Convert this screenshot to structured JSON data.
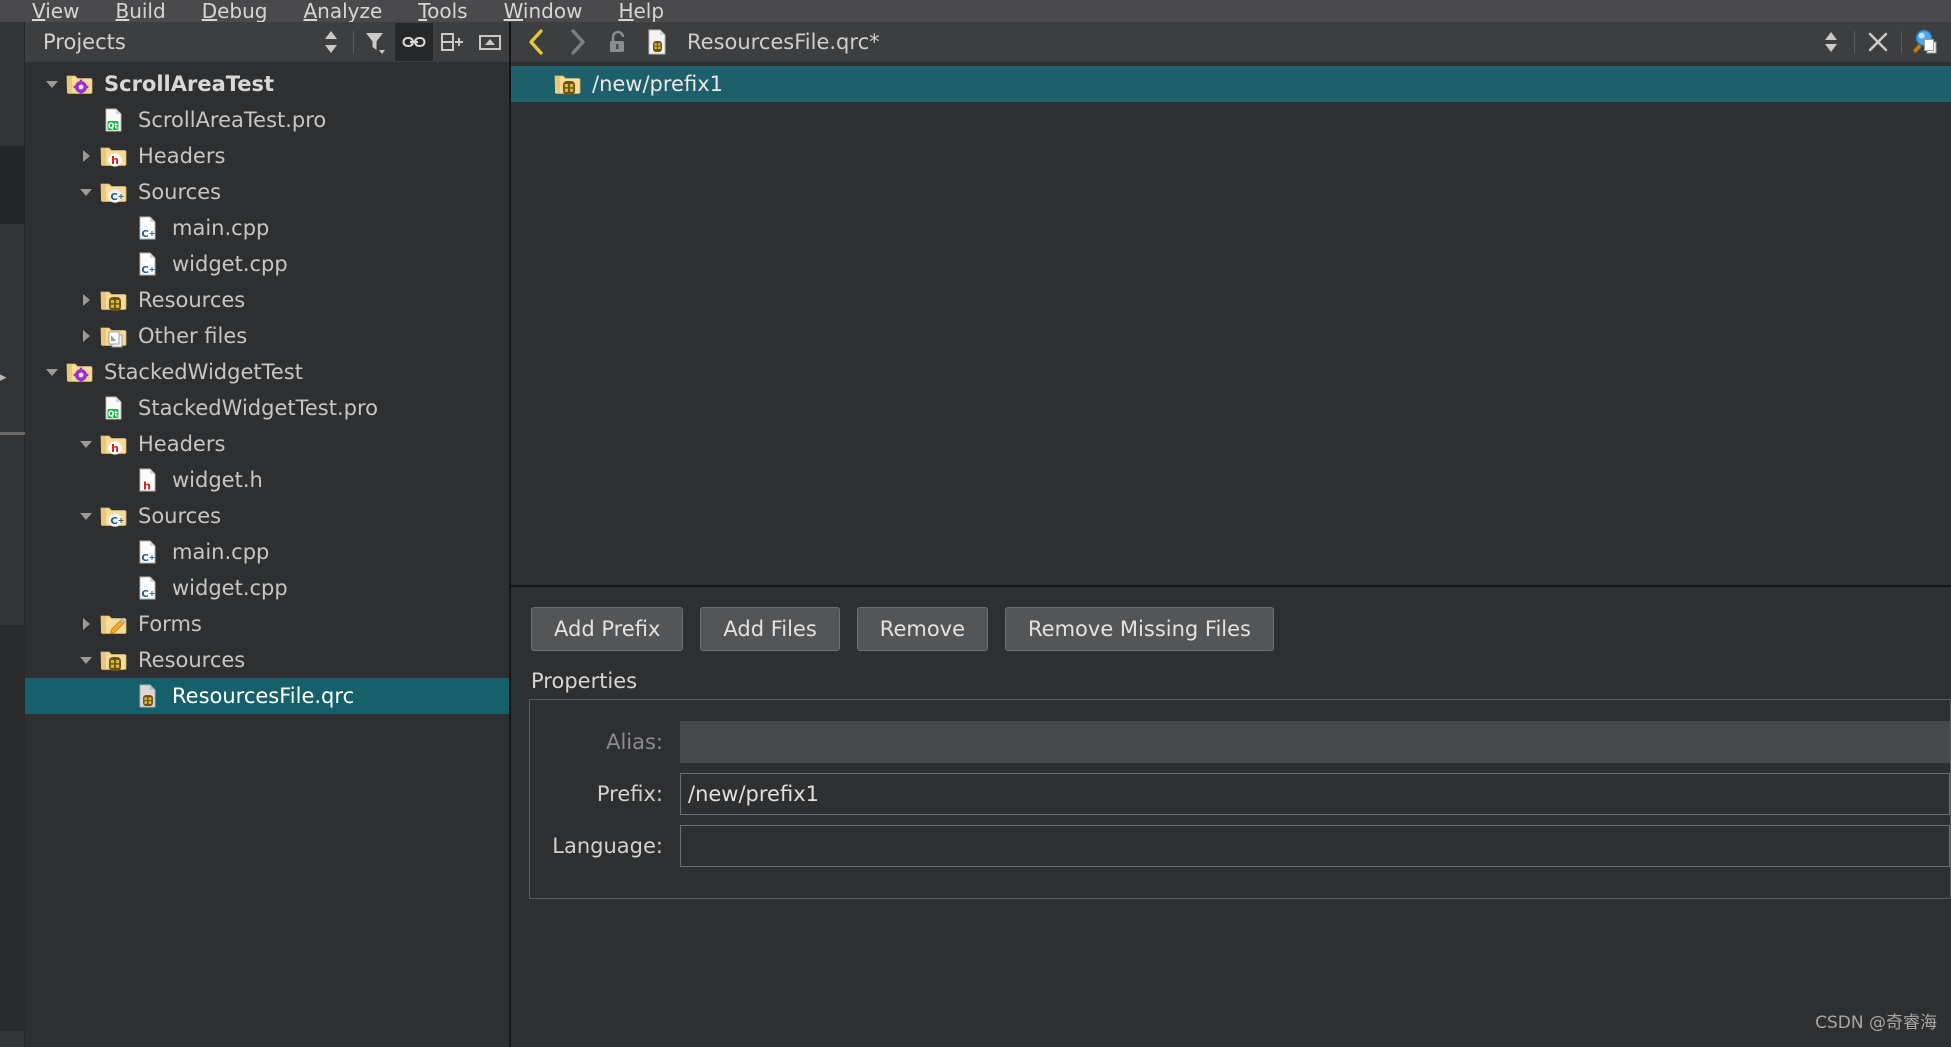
{
  "menubar": {
    "items": [
      {
        "label": "View",
        "accel": "V"
      },
      {
        "label": "Build",
        "accel": "B"
      },
      {
        "label": "Debug",
        "accel": "D"
      },
      {
        "label": "Analyze",
        "accel": "A"
      },
      {
        "label": "Tools",
        "accel": "T"
      },
      {
        "label": "Window",
        "accel": "W"
      },
      {
        "label": "Help",
        "accel": "H"
      }
    ]
  },
  "sidebar": {
    "title": "Projects",
    "toolbar": [
      {
        "name": "sort-order-button",
        "icon": "updown-arrows-icon"
      },
      {
        "name": "filter-button",
        "icon": "filter-icon"
      },
      {
        "name": "synchronize-with-editor-button",
        "icon": "link-icon",
        "active": true
      },
      {
        "name": "split-view-button",
        "icon": "split-add-icon"
      },
      {
        "name": "close-sidebar-button",
        "icon": "collapse-icon"
      }
    ],
    "tree": [
      {
        "label": "ScrollAreaTest",
        "indent": 0,
        "twisty": "open",
        "icon": "project-folder-icon",
        "bold": true,
        "selected": false
      },
      {
        "label": "ScrollAreaTest.pro",
        "indent": 1,
        "twisty": "none",
        "icon": "qt-pro-file-icon",
        "bold": false,
        "selected": false
      },
      {
        "label": "Headers",
        "indent": 1,
        "twisty": "closed",
        "icon": "headers-folder-icon",
        "bold": false,
        "selected": false
      },
      {
        "label": "Sources",
        "indent": 1,
        "twisty": "open",
        "icon": "sources-folder-icon",
        "bold": false,
        "selected": false
      },
      {
        "label": "main.cpp",
        "indent": 2,
        "twisty": "none",
        "icon": "cpp-file-icon",
        "bold": false,
        "selected": false
      },
      {
        "label": "widget.cpp",
        "indent": 2,
        "twisty": "none",
        "icon": "cpp-file-icon",
        "bold": false,
        "selected": false
      },
      {
        "label": "Resources",
        "indent": 1,
        "twisty": "closed",
        "icon": "resources-folder-icon",
        "bold": false,
        "selected": false
      },
      {
        "label": "Other files",
        "indent": 1,
        "twisty": "closed",
        "icon": "other-files-folder-icon",
        "bold": false,
        "selected": false
      },
      {
        "label": "StackedWidgetTest",
        "indent": 0,
        "twisty": "open",
        "icon": "project-folder-icon",
        "bold": false,
        "selected": false
      },
      {
        "label": "StackedWidgetTest.pro",
        "indent": 1,
        "twisty": "none",
        "icon": "qt-pro-file-icon",
        "bold": false,
        "selected": false
      },
      {
        "label": "Headers",
        "indent": 1,
        "twisty": "open",
        "icon": "headers-folder-icon",
        "bold": false,
        "selected": false
      },
      {
        "label": "widget.h",
        "indent": 2,
        "twisty": "none",
        "icon": "h-file-icon",
        "bold": false,
        "selected": false
      },
      {
        "label": "Sources",
        "indent": 1,
        "twisty": "open",
        "icon": "sources-folder-icon",
        "bold": false,
        "selected": false
      },
      {
        "label": "main.cpp",
        "indent": 2,
        "twisty": "none",
        "icon": "cpp-file-icon",
        "bold": false,
        "selected": false
      },
      {
        "label": "widget.cpp",
        "indent": 2,
        "twisty": "none",
        "icon": "cpp-file-icon",
        "bold": false,
        "selected": false
      },
      {
        "label": "Forms",
        "indent": 1,
        "twisty": "closed",
        "icon": "forms-folder-icon",
        "bold": false,
        "selected": false
      },
      {
        "label": "Resources",
        "indent": 1,
        "twisty": "open",
        "icon": "resources-folder-icon",
        "bold": false,
        "selected": false
      },
      {
        "label": "ResourcesFile.qrc",
        "indent": 2,
        "twisty": "none",
        "icon": "qrc-file-icon",
        "bold": false,
        "selected": true
      }
    ]
  },
  "editor": {
    "toolbar": {
      "back_icon": "back-chevron-icon",
      "forward_icon": "forward-chevron-icon",
      "lock_icon": "unlocked-padlock-icon",
      "file_icon": "qrc-file-icon",
      "filename": "ResourcesFile.qrc*",
      "dropdown_icon": "updown-arrows-icon",
      "close_icon": "close-x-icon",
      "search_icon": "magnifier-documents-icon"
    },
    "qrc_tree": [
      {
        "label": "/new/prefix1",
        "icon": "prefix-folder-icon",
        "selected": true
      }
    ],
    "buttons": [
      {
        "label": "Add Prefix",
        "name": "add-prefix-button"
      },
      {
        "label": "Add Files",
        "name": "add-files-button"
      },
      {
        "label": "Remove",
        "name": "remove-button"
      },
      {
        "label": "Remove Missing Files",
        "name": "remove-missing-files-button"
      }
    ],
    "properties": {
      "title": "Properties",
      "fields": [
        {
          "label": "Alias:",
          "value": "",
          "disabled": true,
          "name": "alias-field"
        },
        {
          "label": "Prefix:",
          "value": "/new/prefix1",
          "disabled": false,
          "name": "prefix-field"
        },
        {
          "label": "Language:",
          "value": "",
          "disabled": false,
          "name": "language-field"
        }
      ]
    }
  },
  "watermark": "CSDN @奇睿海",
  "colors": {
    "accent_selection": "#16606b",
    "qrc_selection": "#1d5f6a",
    "toolbar_bg": "#3d3e40",
    "panel_bg": "#2e2f30",
    "back_chevron": "#e8c43c"
  }
}
